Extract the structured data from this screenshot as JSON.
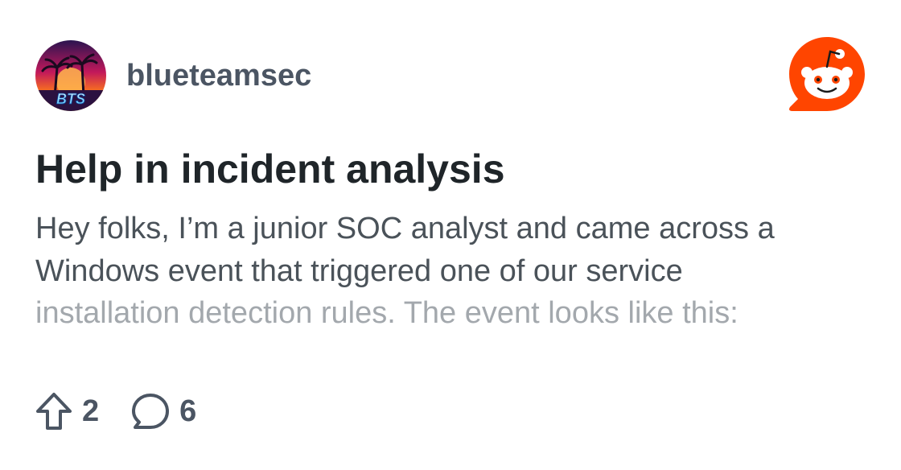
{
  "post": {
    "author": "blueteamsec",
    "avatar_icon": "blueteamsec-avatar",
    "title": "Help in incident analysis",
    "body_lines": [
      "Hey folks, I’m a junior SOC analyst and came across a",
      "Windows event that triggered one of our service",
      "installation detection rules. The event looks like this:"
    ]
  },
  "stats": {
    "upvotes": "2",
    "comments": "6",
    "upvote_icon": "upvote-arrow-icon",
    "comment_icon": "comment-bubble-icon"
  },
  "brand": {
    "logo_icon": "reddit-logo-icon",
    "color": "#ff4500"
  },
  "colors": {
    "title": "#1f2529",
    "body": "#4a5259",
    "body_faded": "#a3a8ad",
    "muted": "#4b5563"
  }
}
